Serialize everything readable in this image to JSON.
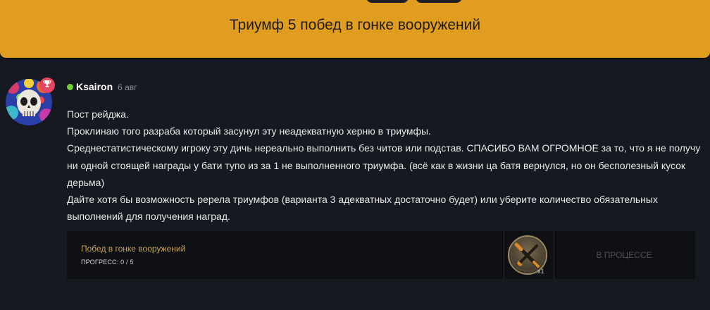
{
  "banner": {
    "title": "Триумф 5 побед в гонке вооружений"
  },
  "post": {
    "author": "Ksairon",
    "date": "6 авг",
    "online": true,
    "badge_icon": "trophy-icon",
    "lines": [
      "Пост рейджа.",
      "Проклинаю того разраба который засунул эту неадекватную херню в триумфы.",
      "Среднестатистическому игроку эту дичь нереально выполнить без читов или подстав. СПАСИБО ВАМ ОГРОМНОЕ за то, что я не получу ни одной стоящей награды у бати тупо из за 1 не выполненного триумфа. (всё как в жизни ца батя вернулся, но он бесполезный кусок дерьма)",
      "Дайте хотя бы возможность ререла триумфов (варианта 3 адекватных достаточно будет) или уберите количество обязательных выполнений для получения наград."
    ]
  },
  "achievement": {
    "name": "Побед в гонке вооружений",
    "progress_label": "ПРОГРЕСС: 0 / 5",
    "progress_value": 0,
    "progress_max": 5,
    "icon": "crossed-weapons-icon",
    "multiplier": "x1",
    "status": "В ПРОЦЕССЕ"
  },
  "colors": {
    "banner": "#e19d1f",
    "background": "#171921",
    "online": "#6fd12e",
    "badge": "#e2475f",
    "achievement_name": "#c9a35b"
  }
}
